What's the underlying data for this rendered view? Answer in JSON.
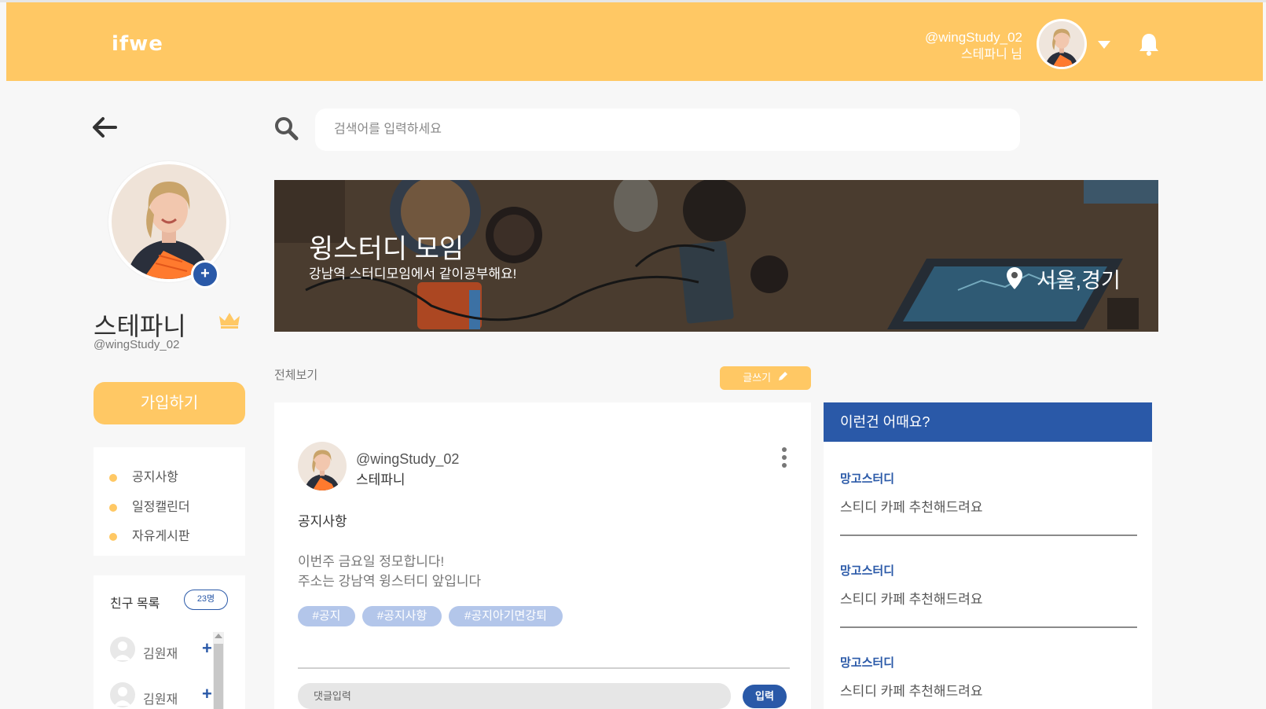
{
  "header": {
    "logo": "ifwe",
    "user_handle": "@wingStudy_02",
    "user_name": "스테파니 님"
  },
  "sidebar": {
    "profile_name": "스테파니",
    "profile_handle": "@wingStudy_02",
    "join_button": "가입하기",
    "menu": [
      {
        "label": "공지사항"
      },
      {
        "label": "일정캘린더"
      },
      {
        "label": "자유게시판"
      }
    ],
    "friends": {
      "title": "친구 목록",
      "count": "23명",
      "items": [
        {
          "name": "김원재"
        },
        {
          "name": "김원재"
        }
      ]
    }
  },
  "search": {
    "placeholder": "검색어를 입력하세요"
  },
  "banner": {
    "title": "윙스터디 모임",
    "subtitle": "강남역 스터디모임에서 같이공부해요!",
    "location": "서울,경기"
  },
  "feed": {
    "view_all": "전체보기",
    "write_button": "글쓰기"
  },
  "post": {
    "handle": "@wingStudy_02",
    "author": "스테파니",
    "category": "공지사항",
    "lines": [
      "이번주 금요일 정모합니다!",
      "주소는 강남역 윙스터디 앞입니다"
    ],
    "tags": [
      "#공지",
      "#공지사항",
      "#공지아기면강퇴"
    ],
    "comment_placeholder": "댓글입력",
    "comment_button": "입력"
  },
  "recommend": {
    "title": "이런건 어때요?",
    "items": [
      {
        "title": "망고스터디",
        "desc": "스티디 카페 추천해드려요"
      },
      {
        "title": "망고스터디",
        "desc": "스티디 카페 추천해드려요"
      },
      {
        "title": "망고스터디",
        "desc": "스티디 카페 추천해드려요"
      }
    ]
  },
  "colors": {
    "accent_yellow": "#ffc864",
    "accent_blue": "#2a59a8",
    "tag_blue": "#b3c6ea"
  },
  "icons": [
    "bell-icon",
    "chevron-down-icon",
    "back-arrow-icon",
    "search-icon",
    "crown-icon",
    "location-pin-icon",
    "pencil-icon",
    "more-vertical-icon"
  ]
}
